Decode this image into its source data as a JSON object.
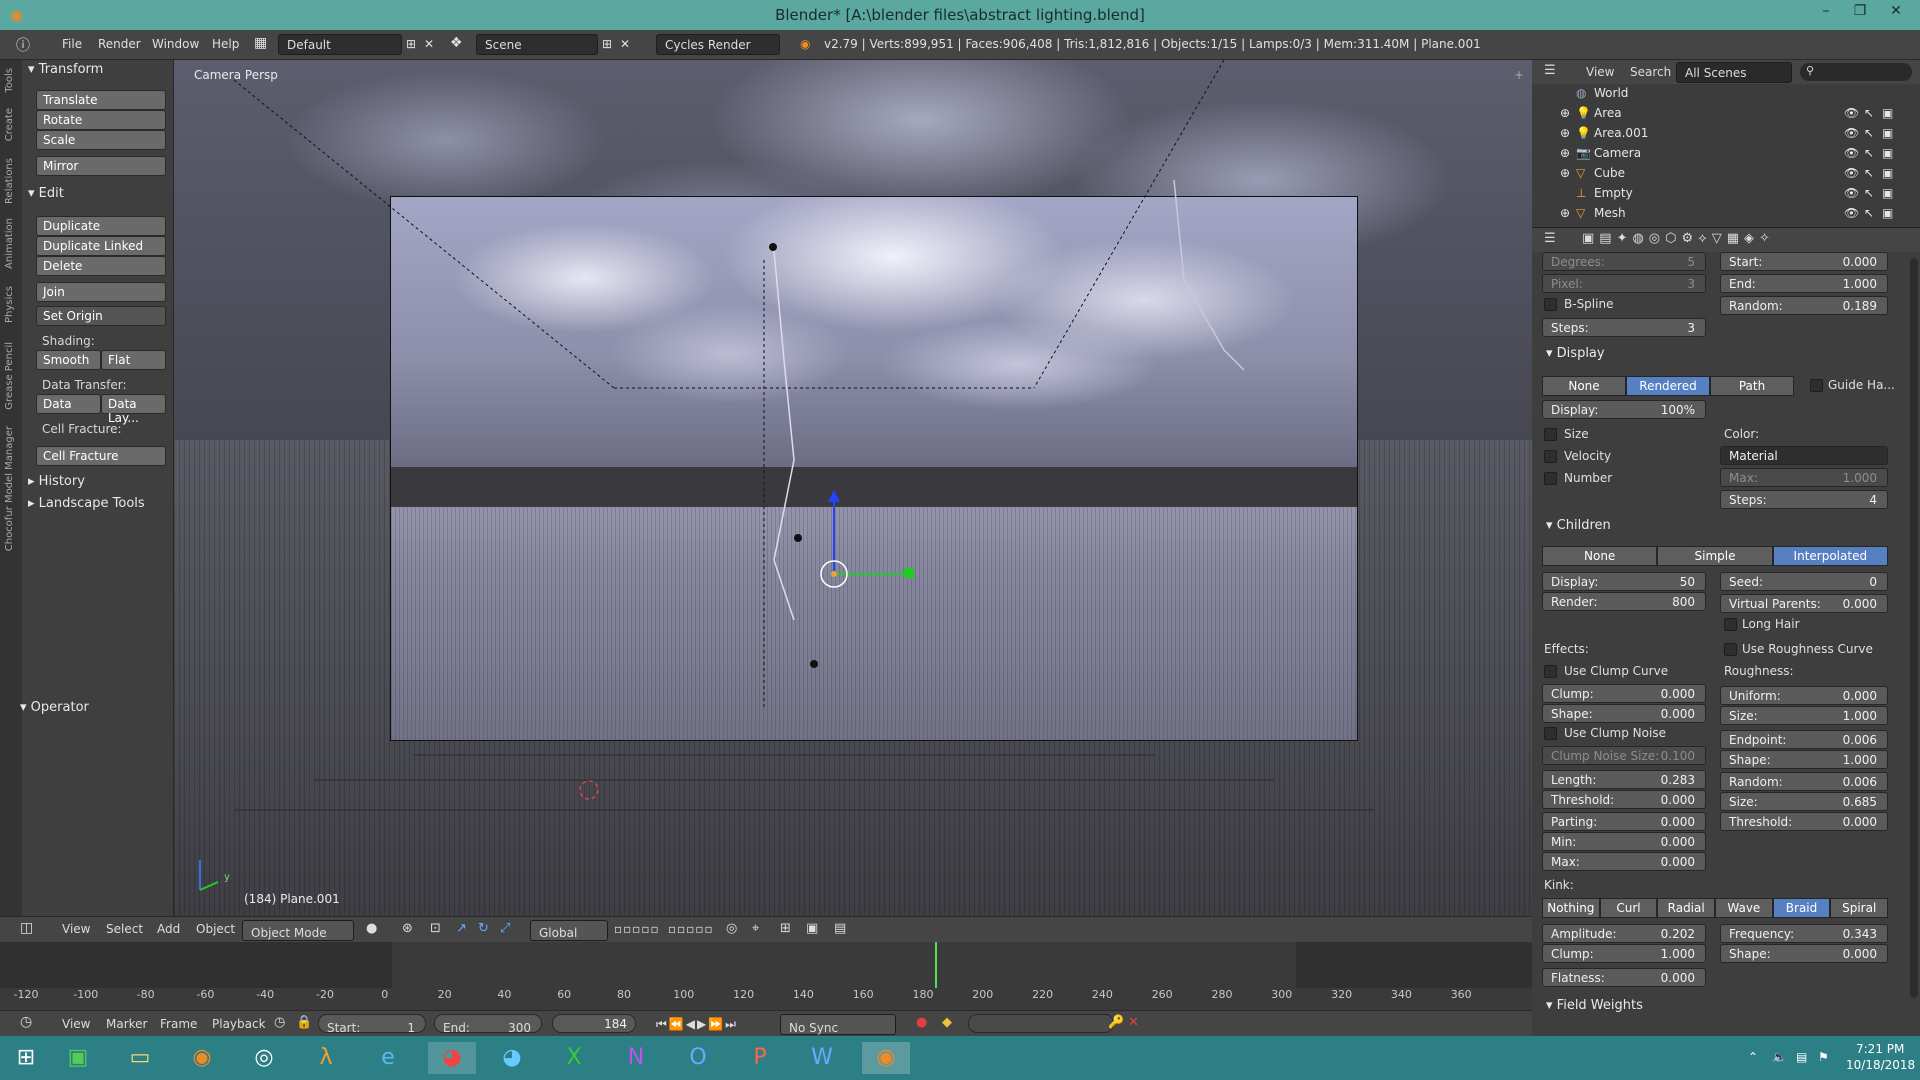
{
  "window": {
    "title": "Blender* [A:\\blender files\\abstract lighting.blend]",
    "minimize": "–",
    "maximize": "❐",
    "close": "✕"
  },
  "infobar": {
    "menus": [
      "File",
      "Render",
      "Window",
      "Help"
    ],
    "layout": "Default",
    "scene": "Scene",
    "engine": "Cycles Render",
    "stats": "v2.79 | Verts:899,951 | Faces:906,408 | Tris:1,812,816 | Objects:1/15 | Lamps:0/3 | Mem:311.40M | Plane.001"
  },
  "side_tabs": [
    "Tools",
    "Create",
    "Relations",
    "Animation",
    "Physics",
    "Grease Pencil",
    "Chocofur Model Manager"
  ],
  "toolshelf": {
    "transform_header": "Transform",
    "translate": "Translate",
    "rotate": "Rotate",
    "scale": "Scale",
    "mirror": "Mirror",
    "edit_header": "Edit",
    "duplicate": "Duplicate",
    "duplicate_linked": "Duplicate Linked",
    "delete": "Delete",
    "join": "Join",
    "set_origin": "Set Origin",
    "shading_label": "Shading:",
    "smooth": "Smooth",
    "flat": "Flat",
    "data_transfer_label": "Data Transfer:",
    "data": "Data",
    "data_layout": "Data Lay...",
    "cell_fracture_label": "Cell Fracture:",
    "cell_fracture": "Cell Fracture",
    "history": "History",
    "landscape_tools": "Landscape Tools",
    "operator": "Operator"
  },
  "viewport": {
    "persp_label": "Camera Persp",
    "object_label": "(184) Plane.001",
    "axis_y": "y"
  },
  "view_header": {
    "items": [
      "View",
      "Select",
      "Add",
      "Object"
    ],
    "mode": "Object Mode",
    "orientation": "Global"
  },
  "timeline": {
    "ruler": [
      "-120",
      "-100",
      "-80",
      "-60",
      "-40",
      "-20",
      "0",
      "20",
      "40",
      "60",
      "80",
      "100",
      "120",
      "140",
      "160",
      "180",
      "200",
      "220",
      "240",
      "260",
      "280",
      "300",
      "320",
      "340",
      "360"
    ],
    "current_frame": 184
  },
  "timeline_header": {
    "items": [
      "View",
      "Marker",
      "Frame",
      "Playback"
    ],
    "start": "Start:",
    "start_val": "1",
    "end": "End:",
    "end_val": "300",
    "frame": "184",
    "sync": "No Sync"
  },
  "outliner": {
    "view": "View",
    "search": "Search",
    "scope": "All Scenes",
    "items": [
      "World",
      "Area",
      "Area.001",
      "Camera",
      "Cube",
      "Empty",
      "Mesh"
    ]
  },
  "props": {
    "degrees": "Degrees:",
    "degrees_v": "5",
    "start": "Start:",
    "start_v": "0.000",
    "pixel": "Pixel:",
    "pixel_v": "3",
    "end": "End:",
    "end_v": "1.000",
    "bspline": "B-Spline",
    "random": "Random:",
    "random_v": "0.189",
    "steps": "Steps:",
    "steps_v": "3",
    "display_header": "Display",
    "display_modes": [
      "None",
      "Rendered",
      "Path"
    ],
    "guide": "Guide Ha...",
    "display_pct": "Display:",
    "display_pct_v": "100%",
    "size": "Size",
    "velocity": "Velocity",
    "number": "Number",
    "color": "Color:",
    "color_v": "Material",
    "max": "Max:",
    "max_v": "1.000",
    "steps2": "Steps:",
    "steps2_v": "4",
    "children_header": "Children",
    "children_modes": [
      "None",
      "Simple",
      "Interpolated"
    ],
    "c_display": "Display:",
    "c_display_v": "50",
    "seed": "Seed:",
    "seed_v": "0",
    "c_render": "Render:",
    "c_render_v": "800",
    "vparents": "Virtual Parents:",
    "vparents_v": "0.000",
    "long_hair": "Long Hair",
    "effects": "Effects:",
    "use_rough_curve": "Use Roughness Curve",
    "use_clump_curve": "Use Clump Curve",
    "roughness": "Roughness:",
    "clump": "Clump:",
    "clump_v": "0.000",
    "uniform": "Uniform:",
    "uniform_v": "0.000",
    "shape": "Shape:",
    "shape_v": "0.000",
    "r_size": "Size:",
    "r_size_v": "1.000",
    "use_clump_noise": "Use Clump Noise",
    "endpoint": "Endpoint:",
    "endpoint_v": "0.006",
    "clump_noise_size": "Clump Noise Size:",
    "clump_noise_size_v": "0.100",
    "e_shape": "Shape:",
    "e_shape_v": "1.000",
    "length": "Length:",
    "length_v": "0.283",
    "r_random": "Random:",
    "r_random_v": "0.006",
    "threshold": "Threshold:",
    "threshold_v": "0.000",
    "r2_size": "Size:",
    "r2_size_v": "0.685",
    "parting": "Parting:",
    "parting_v": "0.000",
    "r_threshold": "Threshold:",
    "r_threshold_v": "0.000",
    "min": "Min:",
    "min_v": "0.000",
    "pmax": "Max:",
    "pmax_v": "0.000",
    "kink": "Kink:",
    "kink_modes": [
      "Nothing",
      "Curl",
      "Radial",
      "Wave",
      "Braid",
      "Spiral"
    ],
    "amplitude": "Amplitude:",
    "amplitude_v": "0.202",
    "frequency": "Frequency:",
    "frequency_v": "0.343",
    "k_clump": "Clump:",
    "k_clump_v": "1.000",
    "k_shape": "Shape:",
    "k_shape_v": "0.000",
    "flatness": "Flatness:",
    "flatness_v": "0.000",
    "field_weights": "Field Weights"
  },
  "taskbar": {
    "time": "7:21 PM",
    "date": "10/18/2018"
  }
}
